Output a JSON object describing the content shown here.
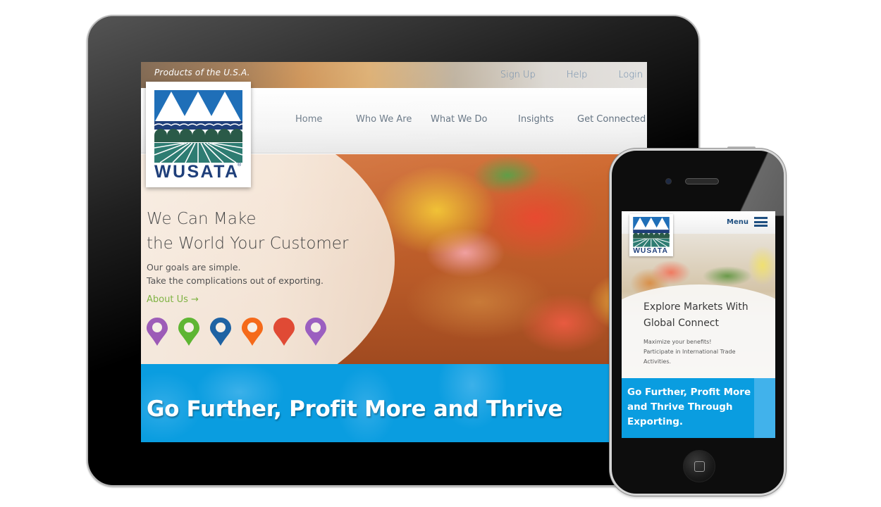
{
  "tablet": {
    "topbar": {
      "tagline": "Products of the U.S.A.",
      "links": [
        "Sign Up",
        "Help",
        "Login"
      ]
    },
    "logo": {
      "text": "WUSATA",
      "registered": "®"
    },
    "nav": [
      "Home",
      "Who We Are",
      "What We Do",
      "Insights",
      "Get Connected"
    ],
    "hero": {
      "title_line1": "We Can Make",
      "title_line2": "the World Your Customer",
      "body_line1": "Our goals are simple.",
      "body_line2": "Take the complications out of exporting.",
      "link": "About Us →",
      "pins": [
        {
          "name": "pin-purple",
          "color": "#9b59b6"
        },
        {
          "name": "pin-green",
          "color": "#5db531"
        },
        {
          "name": "pin-blue",
          "color": "#1d62a3"
        },
        {
          "name": "pin-orange",
          "color": "#f56a1a"
        },
        {
          "name": "pin-red",
          "color": "#e04a35"
        },
        {
          "name": "pin-violet",
          "color": "#9b5fc0"
        }
      ]
    },
    "banner": {
      "text": "Go Further, Profit More and Thrive"
    }
  },
  "phone": {
    "header": {
      "menu_label": "Menu"
    },
    "logo": {
      "text": "WUSATA",
      "registered": "®"
    },
    "hero": {
      "title_line1": "Explore Markets With",
      "title_line2": "Global Connect",
      "body_line1": "Maximize your benefits!",
      "body_line2": "Participate in International Trade",
      "body_line3": "Activities."
    },
    "banner": {
      "line1": "Go Further, Profit More",
      "line2": "and Thrive Through",
      "line3": "Exporting."
    }
  },
  "colors": {
    "brand_blue": "#1f3f7a",
    "banner_blue": "#0a9de0",
    "link_green": "#7ab03c",
    "nav_text": "#5a6a7a"
  }
}
